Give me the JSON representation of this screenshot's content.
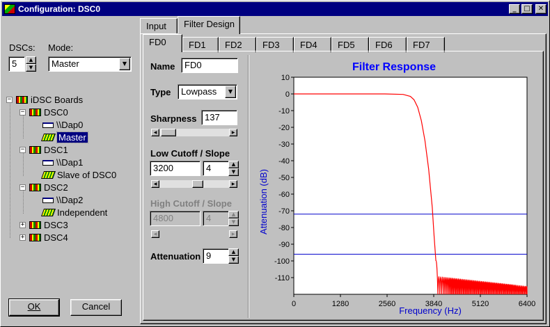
{
  "window": {
    "title": "Configuration: DSC0"
  },
  "left": {
    "dscs_label": "DSCs:",
    "dscs_value": "5",
    "mode_label": "Mode:",
    "mode_value": "Master",
    "tree": {
      "root": "iDSC Boards",
      "dsc0": "DSC0",
      "dap0": "\\\\Dap0",
      "dsc0_mode": "Master",
      "dsc1": "DSC1",
      "dap1": "\\\\Dap1",
      "dsc1_mode": "Slave of DSC0",
      "dsc2": "DSC2",
      "dap2": "\\\\Dap2",
      "dsc2_mode": "Independent",
      "dsc3": "DSC3",
      "dsc4": "DSC4"
    },
    "ok_label": "OK",
    "cancel_label": "Cancel"
  },
  "tabs": {
    "input": "Input",
    "filter_design": "Filter Design"
  },
  "subtabs": [
    "FD0",
    "FD1",
    "FD2",
    "FD3",
    "FD4",
    "FD5",
    "FD6",
    "FD7"
  ],
  "form": {
    "name_label": "Name",
    "name_value": "FD0",
    "type_label": "Type",
    "type_value": "Lowpass",
    "sharpness_label": "Sharpness",
    "sharpness_value": "137",
    "low_label": "Low Cutoff / Slope",
    "low_cutoff_value": "3200",
    "low_slope_value": "4",
    "high_label": "High Cutoff / Slope",
    "high_cutoff_value": "4800",
    "high_slope_value": "4",
    "atten_label": "Attenuation",
    "atten_value": "9"
  },
  "colors": {
    "title_bar": "#000080",
    "plot_title": "#0000ff",
    "response": "#ff0000",
    "limit_lines": "#0000cc"
  },
  "chart_data": {
    "type": "line",
    "title": "Filter Response",
    "xlabel": "Frequency (Hz)",
    "ylabel": "Attenuation (dB)",
    "xlim": [
      0,
      6400
    ],
    "ylim": [
      -120,
      10
    ],
    "xticks": [
      0,
      1280,
      2560,
      3840,
      5120,
      6400
    ],
    "yticks": [
      10,
      0,
      -10,
      -20,
      -30,
      -40,
      -50,
      -60,
      -70,
      -80,
      -90,
      -100,
      -110
    ],
    "grid": false,
    "series": [
      {
        "x": [
          0,
          500,
          1000,
          1500,
          2000,
          2500,
          3000,
          3200,
          3300,
          3400,
          3500,
          3600,
          3700,
          3800,
          3850,
          3900
        ],
        "y": [
          0,
          0,
          0,
          0,
          0,
          0,
          -0.3,
          -1.5,
          -3.5,
          -8,
          -16,
          -28,
          -45,
          -68,
          -85,
          -100
        ]
      }
    ],
    "stopband_ripple": {
      "x_start": 3900,
      "x_end": 6400,
      "top_start": -101,
      "top_end": -113,
      "floor": -120
    },
    "hlines": [
      -72,
      -96
    ]
  }
}
